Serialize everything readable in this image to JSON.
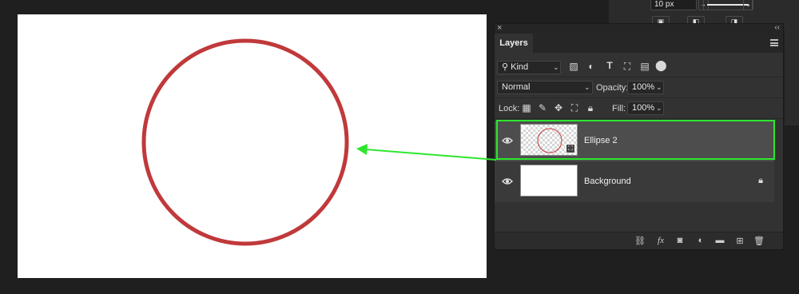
{
  "options_bar": {
    "stroke_size": "10 px",
    "dropdown_glyph": "⌄"
  },
  "layers_panel": {
    "close_glyph": "×",
    "collapse_glyph": "‹‹",
    "tab_label": "Layers",
    "filter": {
      "kind_label": "Kind",
      "search_icon": "search-icon"
    },
    "blend_mode": "Normal",
    "opacity_label": "Opacity:",
    "opacity_value": "100%",
    "lock_label": "Lock:",
    "fill_label": "Fill:",
    "fill_value": "100%",
    "layers": [
      {
        "name": "Ellipse 2",
        "selected": true,
        "visible": true,
        "locked": false
      },
      {
        "name": "Background",
        "selected": false,
        "visible": true,
        "locked": true
      }
    ],
    "bottom_icons": [
      "link-icon",
      "fx-icon",
      "mask-icon",
      "adjustment-icon",
      "folder-icon",
      "new-layer-icon",
      "trash-icon"
    ],
    "fx_label": "fx"
  },
  "canvas": {
    "background": "#ffffff",
    "ellipse_stroke": "#c0393b"
  },
  "annotation": {
    "highlight_color": "#2ee62e",
    "arrow_color": "#2ee62e"
  }
}
